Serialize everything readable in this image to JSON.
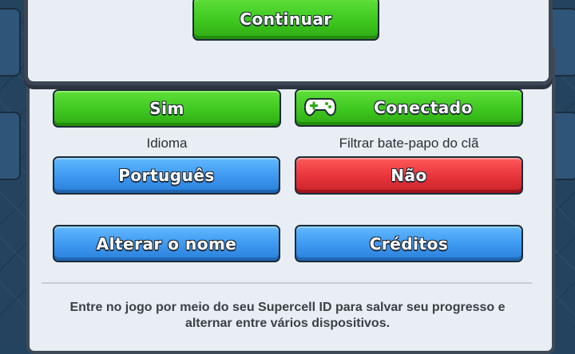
{
  "popup": {
    "continue_label": "Continuar"
  },
  "settings": {
    "music_toggle_label": "Sim",
    "connected_label": "Conectado",
    "language_caption": "Idioma",
    "language_value": "Português",
    "chat_filter_caption": "Filtrar bate-papo do clã",
    "chat_filter_value": "Não",
    "change_name_label": "Alterar o nome",
    "credits_label": "Créditos"
  },
  "info_text": "Entre no jogo por meio do seu Supercell ID para salvar seu progresso e alternar entre vários dispositivos.",
  "colors": {
    "green": "#3ec81f",
    "blue": "#3c97f0",
    "red": "#e7333a",
    "panel": "#e8eef3",
    "background": "#24435e"
  },
  "icons": {
    "connected_icon": "gamepad-icon"
  }
}
